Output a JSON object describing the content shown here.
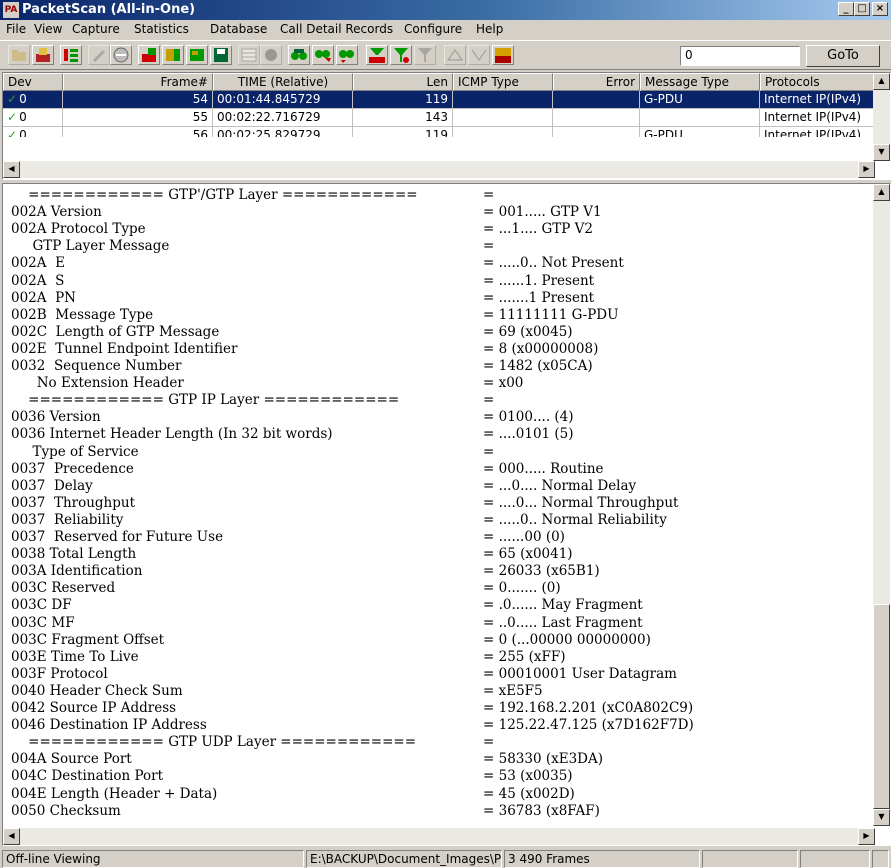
{
  "window": {
    "title": "PacketScan (All-in-One)",
    "icon_text": "PA"
  },
  "menu": [
    "File",
    "View",
    "Capture",
    "Statistics",
    "Database",
    "Call Detail Records",
    "Configure",
    "Help"
  ],
  "toolbar": {
    "goto_value": "0",
    "goto_label": "GoTo"
  },
  "packet_list": {
    "columns": [
      "Dev",
      "Frame#",
      "TIME (Relative)",
      "Len",
      "ICMP Type",
      "Error",
      "Message Type",
      "Protocols"
    ],
    "rows": [
      {
        "dev": "0",
        "frame": "54",
        "time": "00:01:44.845729",
        "len": "119",
        "icmp": "",
        "error": "",
        "msg": "G-PDU",
        "proto": "Internet IP(IPv4)",
        "selected": true
      },
      {
        "dev": "0",
        "frame": "55",
        "time": "00:02:22.716729",
        "len": "143",
        "icmp": "",
        "error": "",
        "msg": "",
        "proto": "Internet IP(IPv4)",
        "selected": false
      },
      {
        "dev": "0",
        "frame": "56",
        "time": "00:02:25.829729",
        "len": "119",
        "icmp": "",
        "error": "",
        "msg": "G-PDU",
        "proto": "Internet IP(IPv4)",
        "selected": false
      }
    ]
  },
  "details": [
    [
      "    ============ GTP'/GTP Layer ============",
      "="
    ],
    [
      "002A Version",
      "= 001..... GTP V1"
    ],
    [
      "002A Protocol Type",
      "= ...1.... GTP V2"
    ],
    [
      "     GTP Layer Message",
      "="
    ],
    [
      "002A  E",
      "= .....0.. Not Present"
    ],
    [
      "002A  S",
      "= ......1. Present"
    ],
    [
      "002A  PN",
      "= .......1 Present"
    ],
    [
      "002B  Message Type",
      "= 11111111 G-PDU"
    ],
    [
      "002C  Length of GTP Message",
      "= 69 (x0045)"
    ],
    [
      "002E  Tunnel Endpoint Identifier",
      "= 8 (x00000008)"
    ],
    [
      "0032  Sequence Number",
      "= 1482 (x05CA)"
    ],
    [
      "      No Extension Header",
      "= x00"
    ],
    [
      "    ============ GTP IP Layer ============",
      "="
    ],
    [
      "0036 Version",
      "= 0100.... (4)"
    ],
    [
      "0036 Internet Header Length (In 32 bit words)",
      "= ....0101 (5)"
    ],
    [
      "     Type of Service",
      "="
    ],
    [
      "0037  Precedence",
      "= 000..... Routine"
    ],
    [
      "0037  Delay",
      "= ...0.... Normal Delay"
    ],
    [
      "0037  Throughput",
      "= ....0... Normal Throughput"
    ],
    [
      "0037  Reliability",
      "= .....0.. Normal Reliability"
    ],
    [
      "0037  Reserved for Future Use",
      "= ......00 (0)"
    ],
    [
      "0038 Total Length",
      "= 65 (x0041)"
    ],
    [
      "003A Identification",
      "= 26033 (x65B1)"
    ],
    [
      "003C Reserved",
      "= 0....... (0)"
    ],
    [
      "003C DF",
      "= .0...... May Fragment"
    ],
    [
      "003C MF",
      "= ..0..... Last Fragment"
    ],
    [
      "003C Fragment Offset",
      "= 0 (...00000 00000000)"
    ],
    [
      "003E Time To Live",
      "= 255 (xFF)"
    ],
    [
      "003F Protocol",
      "= 00010001 User Datagram"
    ],
    [
      "0040 Header Check Sum",
      "= xE5F5"
    ],
    [
      "0042 Source IP Address",
      "= 192.168.2.201 (xC0A802C9)"
    ],
    [
      "0046 Destination IP Address",
      "= 125.22.47.125 (x7D162F7D)"
    ],
    [
      "    ============ GTP UDP Layer ============",
      "="
    ],
    [
      "004A Source Port",
      "= 58330 (xE3DA)"
    ],
    [
      "004C Destination Port",
      "= 53 (x0035)"
    ],
    [
      "004E Length (Header + Data)",
      "= 45 (x002D)"
    ],
    [
      "0050 Checksum",
      "= 36783 (x8FAF)"
    ]
  ],
  "status": {
    "mode": "Off-line Viewing",
    "path": "E:\\BACKUP\\Document_Images\\P",
    "frames": "3 490 Frames"
  }
}
